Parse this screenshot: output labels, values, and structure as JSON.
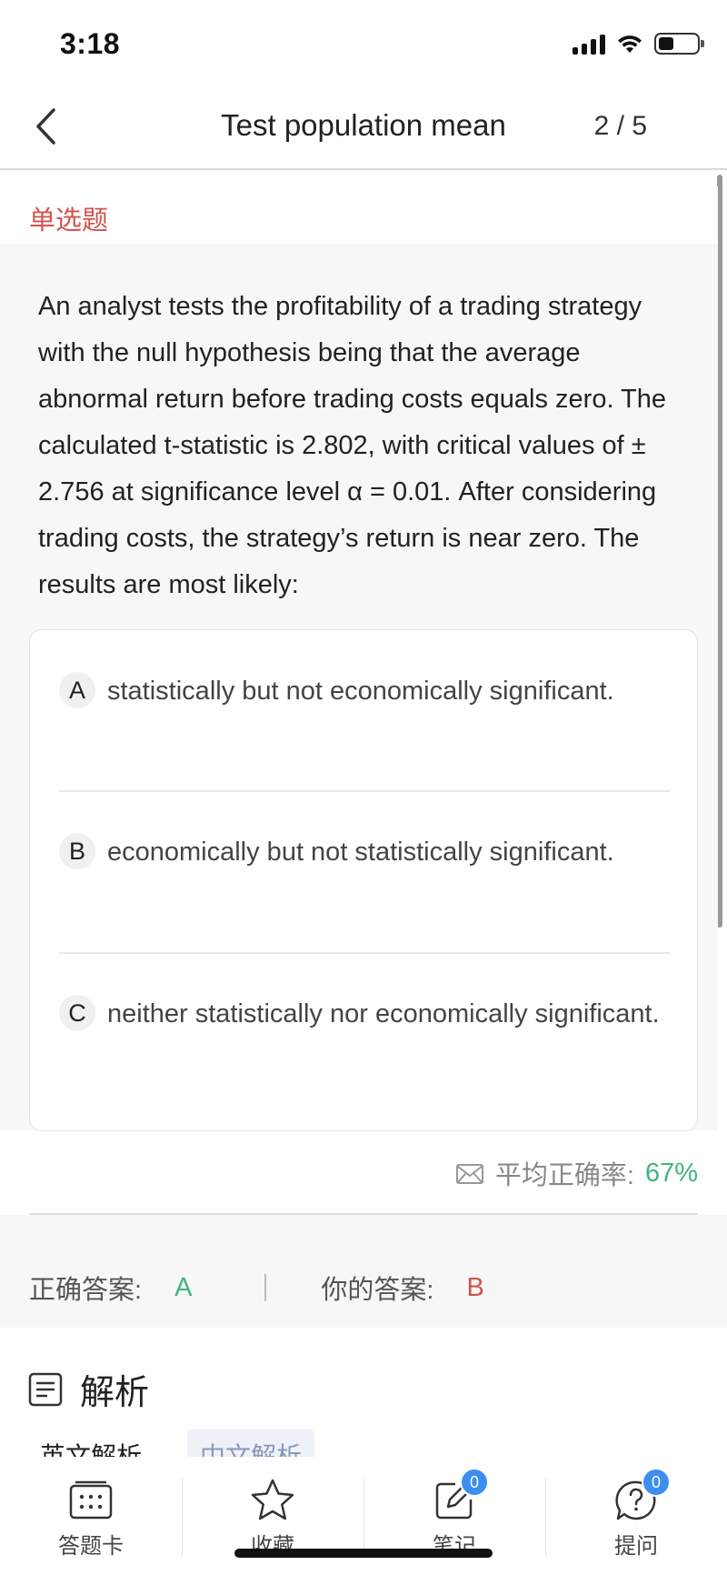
{
  "status_bar": {
    "time": "3:18"
  },
  "nav": {
    "title": "Test population mean",
    "progress": "2 / 5"
  },
  "question": {
    "type_label": "单选题",
    "text": "An analyst tests the profitability of a trading strategy with the null hypothesis being that the average abnormal return before trading costs equals zero. The calculated t-statistic is 2.802, with critical values of ± 2.756 at significance level α = 0.01. After considering trading costs, the strategy’s return is near zero. The results are most likely:"
  },
  "options": [
    {
      "letter": "A",
      "text": "statistically but not economically significant."
    },
    {
      "letter": "B",
      "text": "economically but not statistically significant."
    },
    {
      "letter": "C",
      "text": "neither statistically nor economically significant."
    }
  ],
  "stats": {
    "avg_label": "平均正确率:",
    "avg_value": "67%"
  },
  "answers": {
    "correct_label": "正确答案:",
    "correct_value": "A",
    "yours_label": "你的答案:",
    "yours_value": "B"
  },
  "analysis": {
    "title": "解析",
    "tab_en": "英文解析",
    "tab_cn": "中文解析"
  },
  "bottom_nav": [
    {
      "label": "答题卡",
      "icon": "answer-card-icon",
      "badge": ""
    },
    {
      "label": "收藏",
      "icon": "star-icon",
      "badge": ""
    },
    {
      "label": "笔记",
      "icon": "note-edit-icon",
      "badge": "0"
    },
    {
      "label": "提问",
      "icon": "question-bubble-icon",
      "badge": "0"
    }
  ],
  "colors": {
    "accent_red": "#d0554f",
    "accent_green": "#3fb57a",
    "badge_blue": "#3d8ef0"
  }
}
